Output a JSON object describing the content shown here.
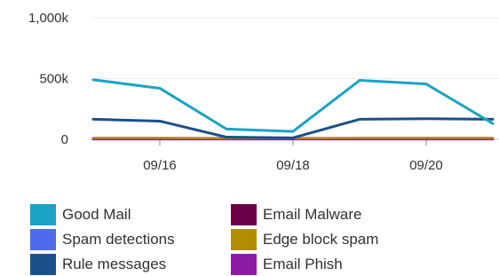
{
  "chart_data": {
    "type": "line",
    "x": [
      "09/15",
      "09/16",
      "09/17",
      "09/18",
      "09/19",
      "09/20",
      "09/21"
    ],
    "x_tick_labels": [
      "09/16",
      "09/18",
      "09/20"
    ],
    "y_tick_labels": [
      "1,000k",
      "500k",
      "0"
    ],
    "ylim": [
      0,
      1000000
    ],
    "grid": true,
    "legend_position": "bottom",
    "series": [
      {
        "name": "Good Mail",
        "color": "#1aa3c6",
        "values": [
          490000,
          420000,
          85000,
          65000,
          485000,
          455000,
          130000
        ]
      },
      {
        "name": "Spam detections",
        "color": "#4f6bed",
        "values": [
          3000,
          3000,
          2000,
          2000,
          3000,
          3000,
          3000
        ]
      },
      {
        "name": "Rule messages",
        "color": "#1b4f8a",
        "values": [
          165000,
          150000,
          18000,
          12000,
          165000,
          170000,
          165000
        ]
      },
      {
        "name": "Email Malware",
        "color": "#6a0047",
        "values": [
          1000,
          1000,
          1000,
          1000,
          1000,
          1000,
          1000
        ]
      },
      {
        "name": "Edge block spam",
        "color": "#b38d00",
        "values": [
          12000,
          12000,
          10000,
          10000,
          12000,
          12000,
          12000
        ]
      },
      {
        "name": "Email Phish",
        "color": "#8e1ba3",
        "values": [
          4000,
          4000,
          3000,
          3000,
          4000,
          4000,
          4000
        ]
      }
    ]
  },
  "legend": {
    "items": [
      {
        "label": "Good Mail",
        "color": "#1aa3c6"
      },
      {
        "label": "Email Malware",
        "color": "#6a0047"
      },
      {
        "label": "Spam detections",
        "color": "#4f6bed"
      },
      {
        "label": "Edge block spam",
        "color": "#b38d00"
      },
      {
        "label": "Rule messages",
        "color": "#1b4f8a"
      },
      {
        "label": "Email Phish",
        "color": "#8e1ba3"
      }
    ]
  }
}
